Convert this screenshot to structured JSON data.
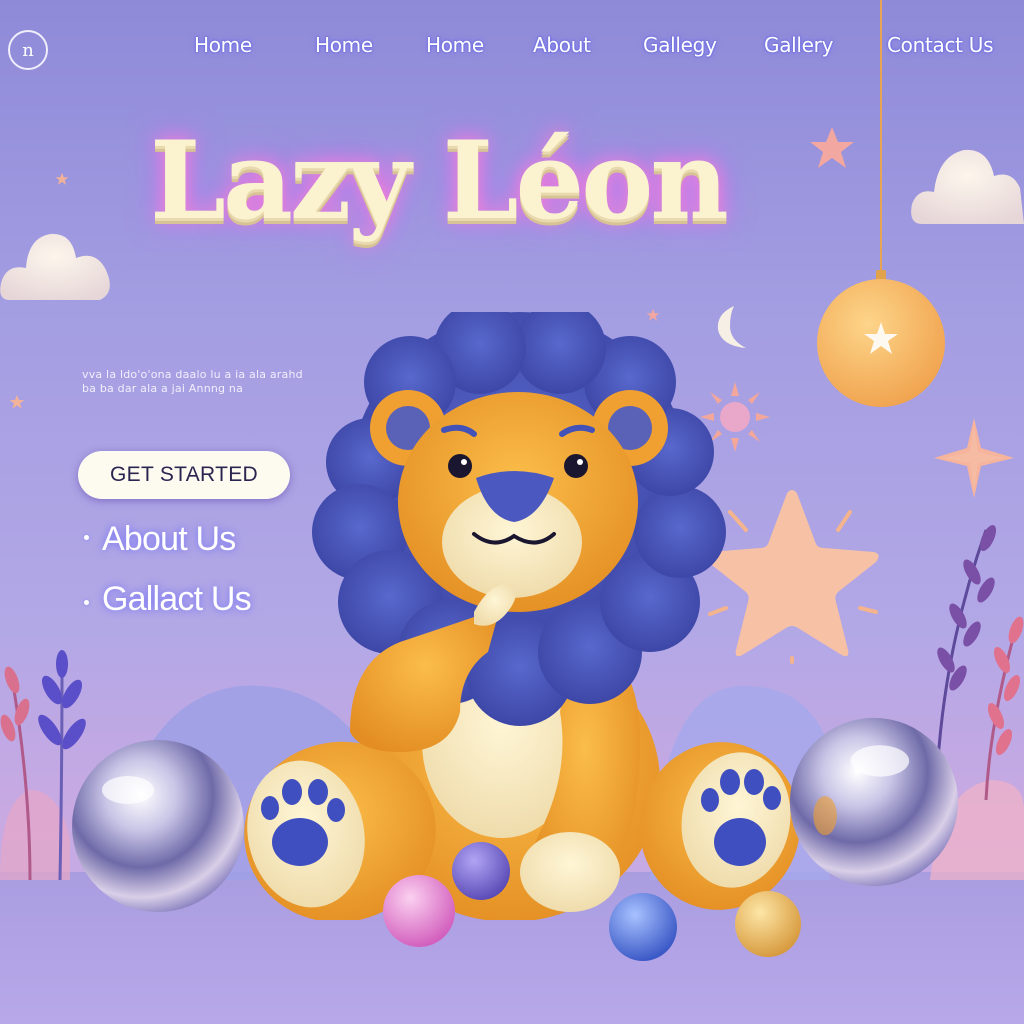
{
  "nav": {
    "logo_text": "n",
    "items": [
      "Home",
      "Home",
      "Home",
      "About",
      "Gallegy",
      "Gallery",
      "Contact Us"
    ]
  },
  "hero": {
    "title": "Lazy Léon",
    "description": "vva la ldo'o'ona daalo lu a ia ala arahd ba ba dar ala a jai Annng na",
    "cta_label": "GET STARTED"
  },
  "side_links": [
    "About Us",
    "Gallact Us"
  ],
  "colors": {
    "background": "#a39de2",
    "title": "#fbf3cf",
    "title_glow": "#ff7fd0",
    "lion_body": "#f3a733",
    "lion_mane": "#4a56b8",
    "cta_bg": "#fdfbf0"
  },
  "icons": [
    "logo-icon",
    "cloud-icon",
    "star-icon",
    "moon-icon",
    "sun-icon",
    "lion-mascot",
    "chrome-sphere",
    "lavender-plant"
  ]
}
